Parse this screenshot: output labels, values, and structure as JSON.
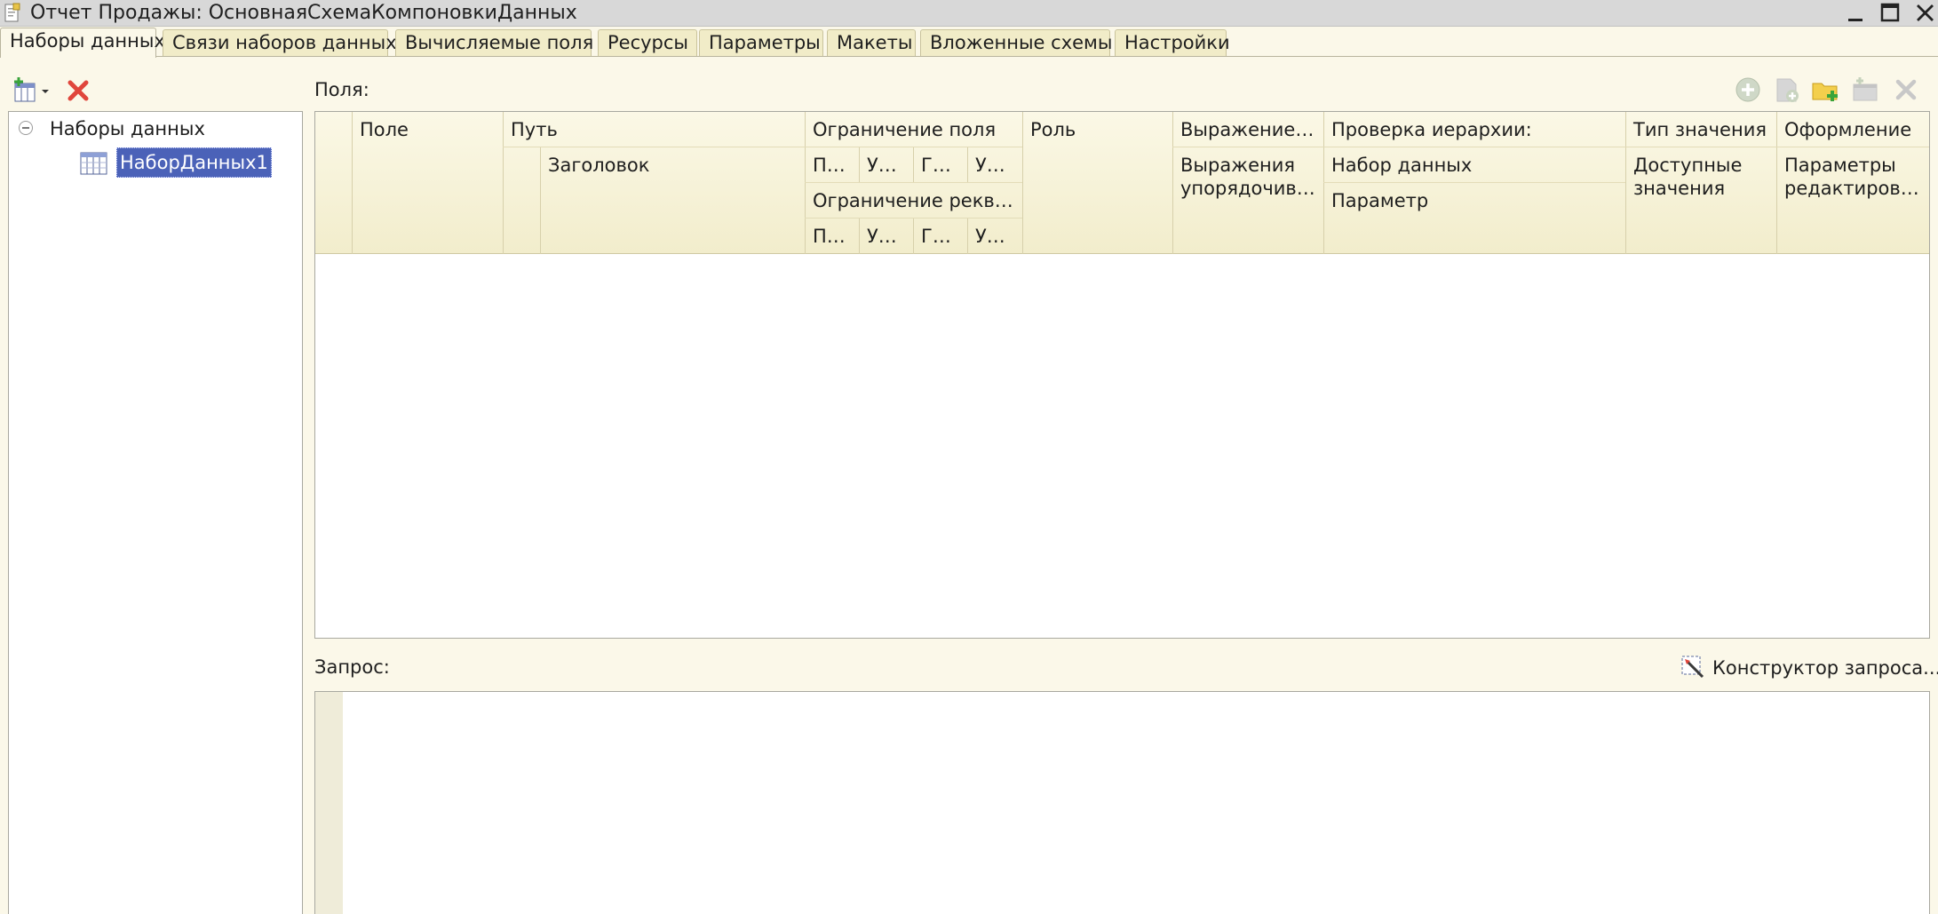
{
  "window": {
    "title": "Отчет Продажы: ОсновнаяСхемаКомпоновкиДанных",
    "minimize_glyph": "_"
  },
  "tabs": [
    {
      "label": "Наборы данных",
      "active": true
    },
    {
      "label": "Связи наборов данных",
      "active": false
    },
    {
      "label": "Вычисляемые поля",
      "active": false
    },
    {
      "label": "Ресурсы",
      "active": false
    },
    {
      "label": "Параметры",
      "active": false
    },
    {
      "label": "Макеты",
      "active": false
    },
    {
      "label": "Вложенные схемы",
      "active": false
    },
    {
      "label": "Настройки",
      "active": false
    }
  ],
  "left_panel": {
    "toolbar": {
      "add_icon": "add-dataset-icon",
      "delete_icon": "delete-icon"
    },
    "tree": {
      "root_label": "Наборы данных",
      "items": [
        {
          "label": "НаборДанных1",
          "selected": true
        }
      ]
    }
  },
  "fields": {
    "label": "Поля:",
    "toolbar_icons": [
      "add-field-icon",
      "add-dataset-field-icon",
      "add-folder-icon",
      "add-set-icon",
      "delete-field-icon"
    ],
    "columns": {
      "field": "Поле",
      "path": "Путь",
      "title": "Заголовок",
      "field_restriction": "Ограничение поля",
      "restriction_sub": [
        "По...",
        "Ус...",
        "Гр...",
        "Уп..."
      ],
      "attribute_restriction": "Ограничение реквиз...",
      "attribute_sub": [
        "По...",
        "Ус...",
        "Гр...",
        "Уп..."
      ],
      "role": "Роль",
      "expression": "Выражение п...",
      "order_expressions": "Выражения упорядочиван",
      "hierarchy_check": "Проверка иерархии:",
      "hierarchy_dataset": "Набор данных",
      "hierarchy_parameter": "Параметр",
      "value_type": "Тип значения",
      "available_values": "Доступные значения",
      "appearance": "Оформление",
      "editing_params": "Параметры редактировани"
    }
  },
  "query": {
    "label": "Запрос:",
    "builder_label": "Конструктор запроса...",
    "builder_icon": "query-builder-icon",
    "text": ""
  },
  "colors": {
    "background": "#fbf8e9",
    "tab_inactive": "#f1ecc8",
    "selection": "#4b62b8",
    "header": "#f4efd2",
    "delete_red": "#e0463c",
    "add_green": "#3aa43a"
  }
}
